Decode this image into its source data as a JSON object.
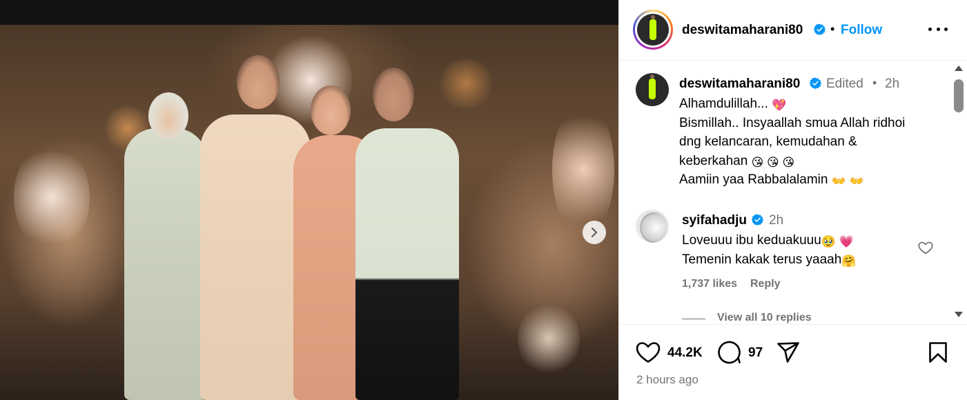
{
  "post": {
    "username": "deswitamaharani80",
    "follow_label": "Follow",
    "separator": "•"
  },
  "caption": {
    "username": "deswitamaharani80",
    "edited": "Edited",
    "separator": "•",
    "time": "2h",
    "lines": [
      "Alhamdulillah...",
      "Bismillah.. Insyaallah smua Allah ridhoi",
      "dng kelancaran, kemudahan &",
      "keberkahan",
      "Aamiin yaa Rabbalalamin"
    ],
    "emojis": {
      "line1": "💖",
      "line4": "😘 😘 😘",
      "line5": "👐 👐"
    }
  },
  "comment": {
    "username": "syifahadju",
    "time": "2h",
    "line1": "Loveuuu ibu keduakuuu",
    "line1_emoji": "🥹 💗",
    "line2": "Temenin kakak terus yaaah",
    "line2_emoji": "🤗",
    "likes": "1,737 likes",
    "reply_label": "Reply",
    "view_replies": "View all 10 replies"
  },
  "actions": {
    "like_count": "44.2K",
    "comment_count": "97",
    "timestamp": "2 hours ago"
  },
  "icons": {
    "verified": "verified-badge-icon",
    "more": "more-options-icon",
    "heart": "heart-icon",
    "comment": "comment-icon",
    "share": "share-icon",
    "save": "bookmark-icon",
    "next": "chevron-right-icon"
  },
  "colors": {
    "link_blue": "#0095f6",
    "muted": "#737373",
    "verified_blue": "#0095f6",
    "emoji_pink": "#e0245e"
  }
}
